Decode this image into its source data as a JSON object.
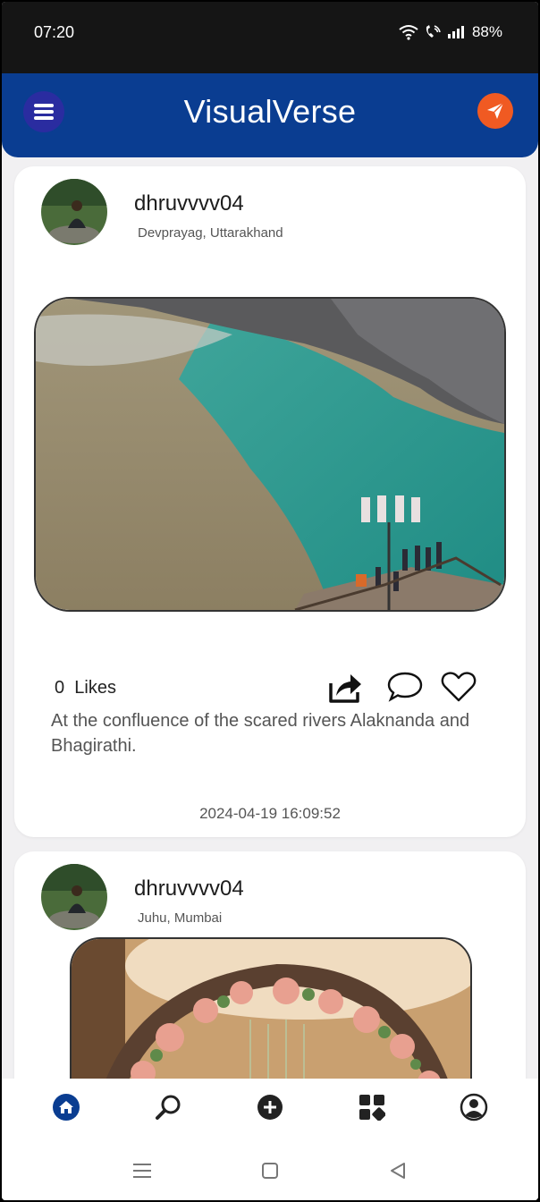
{
  "status": {
    "time": "07:20",
    "battery": "88%"
  },
  "app": {
    "title": "VisualVerse"
  },
  "posts": [
    {
      "username": "dhruvvvv04",
      "location": "Devprayag, Uttarakhand",
      "likes_count": "0",
      "likes_label": "Likes",
      "caption": "At the confluence of the scared rivers Alaknanda and Bhagirathi.",
      "timestamp": "2024-04-19 16:09:52"
    },
    {
      "username": "dhruvvvv04",
      "location": "Juhu, Mumbai"
    }
  ],
  "nav": {
    "items": [
      "home-icon",
      "search-icon",
      "add-icon",
      "grid-icon",
      "profile-icon"
    ],
    "active": "home-icon"
  },
  "colors": {
    "appbar": "#0a3d91",
    "accent": "#f05a22",
    "menu": "#2a2ca0"
  }
}
